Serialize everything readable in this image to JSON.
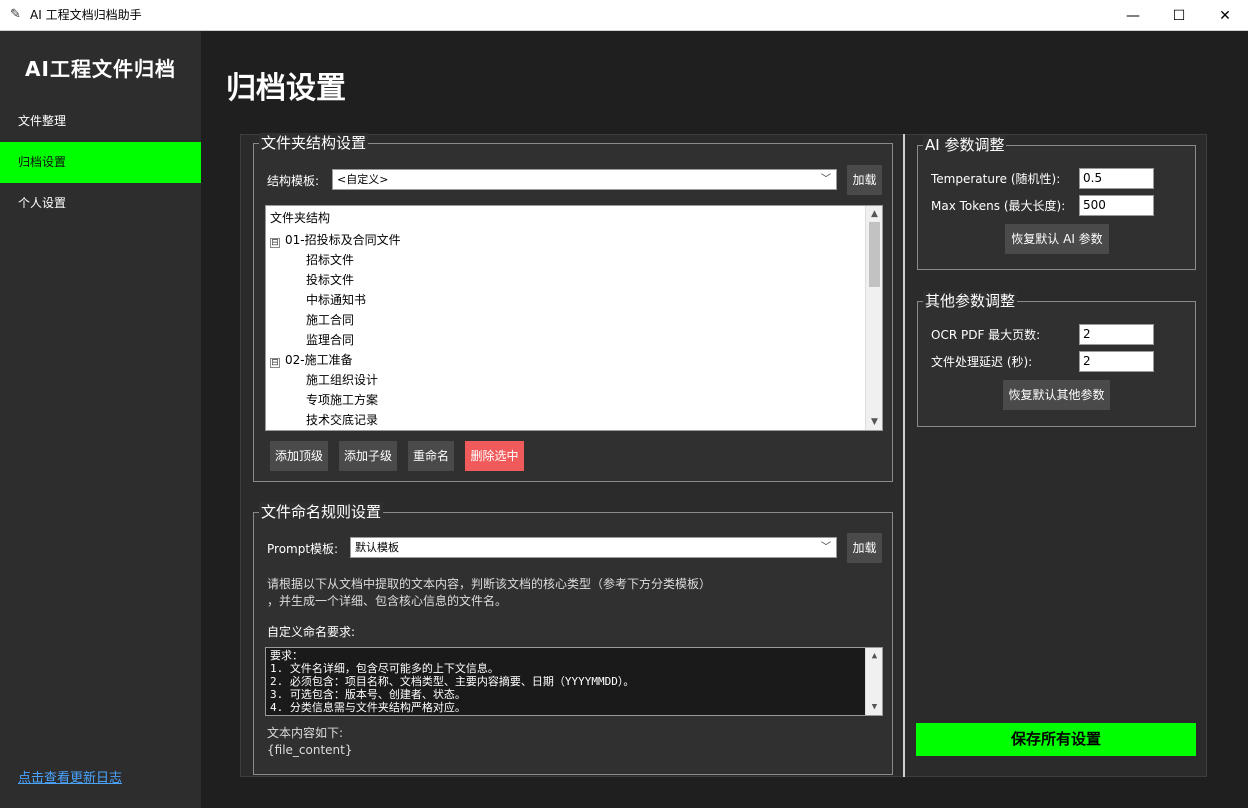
{
  "window": {
    "title": "AI 工程文档归档助手",
    "min": "—",
    "max": "☐",
    "close": "✕"
  },
  "sidebar": {
    "brand": "AI工程文件归档",
    "items": [
      {
        "label": "文件整理"
      },
      {
        "label": "归档设置"
      },
      {
        "label": "个人设置"
      }
    ],
    "changelog": "点击查看更新日志"
  },
  "page": {
    "title": "归档设置"
  },
  "folder_group": {
    "legend": "文件夹结构设置",
    "template_label": "结构模板:",
    "template_value": "<自定义>",
    "load_label": "加载",
    "tree": {
      "header": "文件夹结构",
      "rows": [
        {
          "text": "01-招投标及合同文件",
          "expander": "⊟"
        },
        {
          "text": "招标文件"
        },
        {
          "text": "投标文件"
        },
        {
          "text": "中标通知书"
        },
        {
          "text": "施工合同"
        },
        {
          "text": "监理合同"
        },
        {
          "text": "02-施工准备",
          "expander": "⊟"
        },
        {
          "text": "施工组织设计"
        },
        {
          "text": "专项施工方案"
        },
        {
          "text": "技术交底记录"
        }
      ]
    },
    "buttons": {
      "add_top": "添加顶级",
      "add_child": "添加子级",
      "rename": "重命名",
      "delete": "删除选中"
    }
  },
  "naming_group": {
    "legend": "文件命名规则设置",
    "prompt_label": "Prompt模板:",
    "prompt_value": "默认模板",
    "load_label": "加载",
    "desc_line1": "请根据以下从文档中提取的文本内容，判断该文档的核心类型（参考下方分类模板）",
    "desc_line2": "，并生成一个详细、包含核心信息的文件名。",
    "custom_label": "自定义命名要求:",
    "custom_lines": [
      "要求：",
      "1. 文件名详细，包含尽可能多的上下文信息。",
      "2. 必须包含：项目名称、文档类型、主要内容摘要、日期（YYYYMMDD）。",
      "3. 可选包含：版本号、创建者、状态。",
      "4. 分类信息需与文件夹结构严格对应。"
    ],
    "content_label": "文本内容如下:",
    "content_placeholder": "{file_content}"
  },
  "ai_group": {
    "legend": "AI 参数调整",
    "temperature_label": "Temperature (随机性):",
    "temperature_value": "0.5",
    "max_tokens_label": "Max Tokens (最大长度):",
    "max_tokens_value": "500",
    "reset_label": "恢复默认 AI 参数"
  },
  "other_group": {
    "legend": "其他参数调整",
    "ocr_label": "OCR PDF 最大页数:",
    "ocr_value": "2",
    "delay_label": "文件处理延迟 (秒):",
    "delay_value": "2",
    "reset_label": "恢复默认其他参数"
  },
  "save_label": "保存所有设置",
  "colors": {
    "accent": "#00ff00",
    "danger": "#f05a5a",
    "bg": "#1f1f1f",
    "panel": "#2d2d2d"
  }
}
